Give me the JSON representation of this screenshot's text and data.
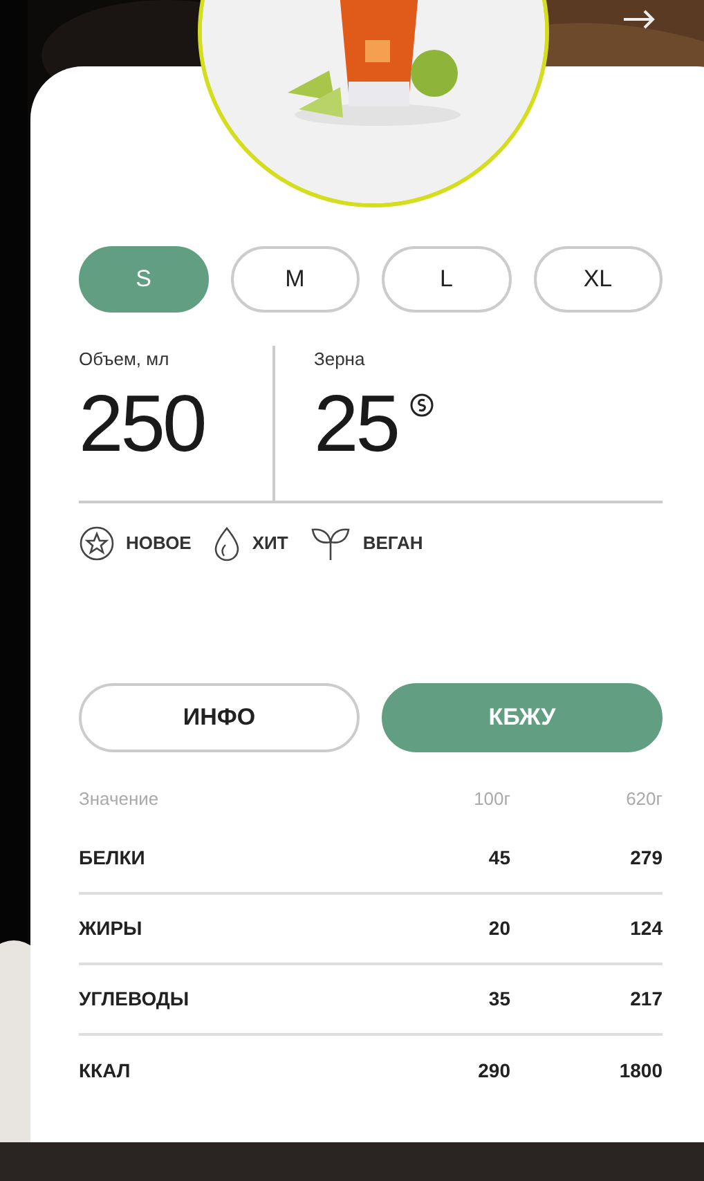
{
  "sizes": [
    {
      "label": "S",
      "selected": true
    },
    {
      "label": "M",
      "selected": false
    },
    {
      "label": "L",
      "selected": false
    },
    {
      "label": "XL",
      "selected": false
    }
  ],
  "stats": [
    {
      "label": "Объем, мл",
      "value": "250",
      "kind": "plain"
    },
    {
      "label": "Зерна",
      "value": "25",
      "kind": "coins"
    }
  ],
  "tags": [
    {
      "label": "НОВОЕ",
      "kind": "star"
    },
    {
      "label": "ХИТ",
      "kind": "flame"
    },
    {
      "label": "ВЕГАН",
      "kind": "leaf"
    }
  ],
  "tabs": [
    {
      "label": "ИНФО",
      "selected": false
    },
    {
      "label": "КБЖУ",
      "selected": true
    }
  ],
  "table": {
    "columns": [
      "Значение",
      "100г",
      "620г"
    ],
    "rows": [
      [
        "БЕЛКИ",
        "45",
        "279"
      ],
      [
        "ЖИРЫ",
        "20",
        "124"
      ],
      [
        "УГЛЕВОДЫ",
        "35",
        "217"
      ],
      [
        "ККАЛ",
        "290",
        "1800"
      ]
    ]
  }
}
